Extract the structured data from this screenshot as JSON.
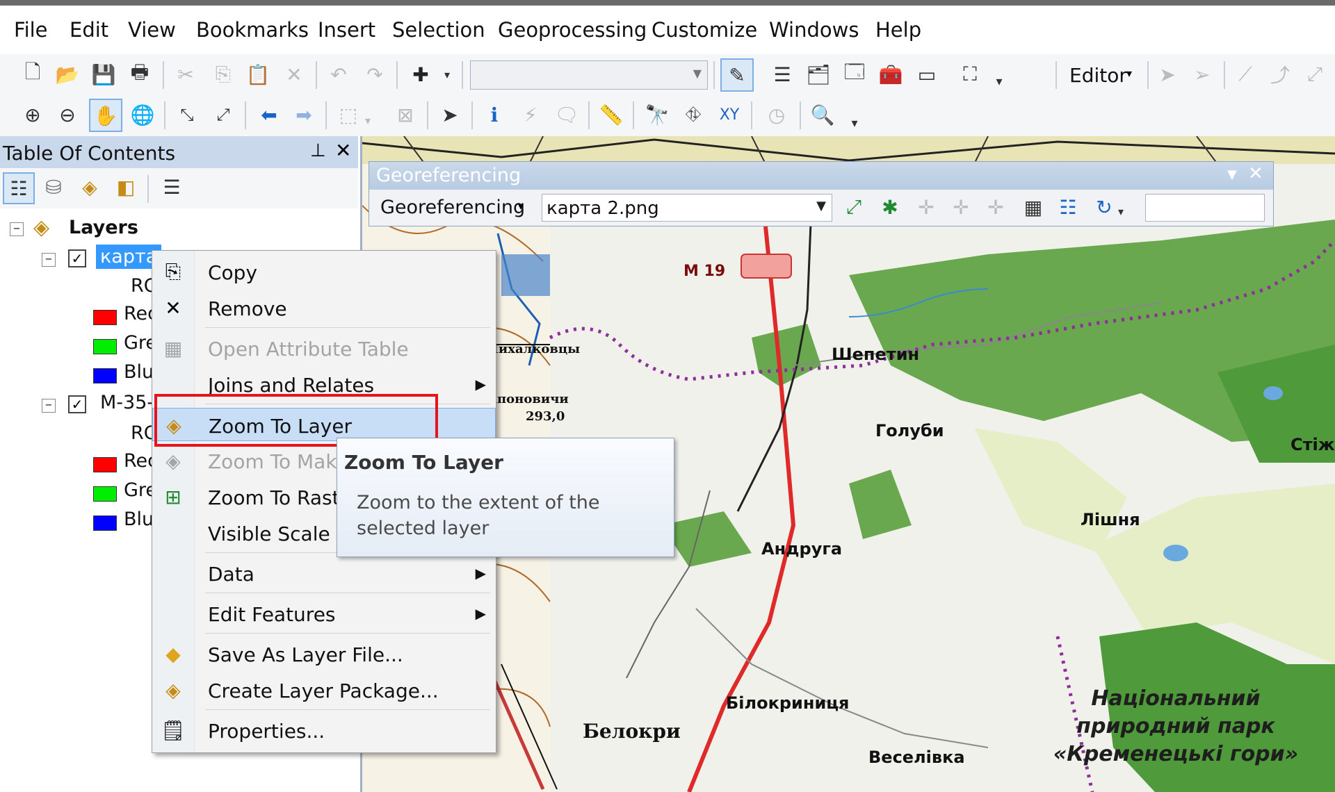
{
  "menu": [
    "File",
    "Edit",
    "View",
    "Bookmarks",
    "Insert",
    "Selection",
    "Geoprocessing",
    "Customize",
    "Windows",
    "Help"
  ],
  "toolbar": {
    "editor_label": "Editor"
  },
  "toc": {
    "title": "Table Of Contents",
    "root": "Layers",
    "layers": [
      {
        "name": "карта",
        "band_group": "RG",
        "bands": [
          "Red",
          "Green",
          "Blue"
        ]
      },
      {
        "name": "M-35-",
        "band_group": "RG",
        "bands": [
          "Red",
          "Green",
          "Blue"
        ]
      }
    ],
    "band_colors": [
      "#ff0000",
      "#00ee00",
      "#0000ff"
    ]
  },
  "georef": {
    "title": "Georeferencing",
    "menu_label": "Georeferencing",
    "layer_value": "карта 2.png"
  },
  "context_menu": {
    "items": [
      {
        "label": "Copy",
        "icon": "copy-icon",
        "enabled": true
      },
      {
        "label": "Remove",
        "icon": "remove-icon",
        "enabled": true
      },
      {
        "label": "Open Attribute Table",
        "icon": "table-icon",
        "enabled": false
      },
      {
        "label": "Joins and Relates",
        "icon": "",
        "enabled": true,
        "submenu": true
      },
      {
        "label": "Zoom To Layer",
        "icon": "zoom-to-layer-icon",
        "enabled": true,
        "highlighted": true
      },
      {
        "label": "Zoom To Make",
        "icon": "zoom-visible-icon",
        "enabled": false
      },
      {
        "label": "Zoom To Raste",
        "icon": "zoom-raster-icon",
        "enabled": true
      },
      {
        "label": "Visible Scale Ra",
        "icon": "",
        "enabled": true
      },
      {
        "label": "Data",
        "icon": "",
        "enabled": true,
        "submenu": true
      },
      {
        "label": "Edit Features",
        "icon": "",
        "enabled": true,
        "submenu": true
      },
      {
        "label": "Save As Layer File...",
        "icon": "layer-file-icon",
        "enabled": true
      },
      {
        "label": "Create Layer Package...",
        "icon": "layer-package-icon",
        "enabled": true
      },
      {
        "label": "Properties...",
        "icon": "properties-icon",
        "enabled": true
      }
    ]
  },
  "tooltip": {
    "title": "Zoom To Layer",
    "description": "Zoom to the extent of the selected layer"
  },
  "map": {
    "road_label": "М 19",
    "places": [
      "Шепетин",
      "Голуби",
      "Андруга",
      "Лішня",
      "Білокриниця",
      "Веселівка",
      "Стіжо"
    ],
    "park_label": "Національний природний парк «Кременецькі гори»",
    "topo_labels": [
      "Белокри",
      "Михалковцы",
      "Сапоновичи",
      "293,0"
    ]
  }
}
